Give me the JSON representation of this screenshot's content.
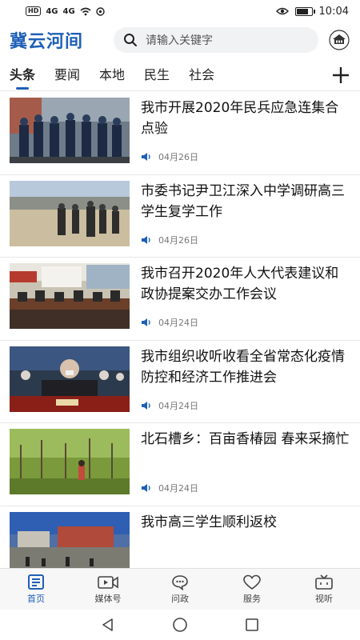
{
  "status_bar": {
    "network_badge": "HD",
    "signal1": "4G",
    "signal2": "4G",
    "time": "10:04",
    "battery_level": 0.85
  },
  "header": {
    "logo_text": "冀云河间",
    "search_placeholder": "请输入关键字"
  },
  "tabs": [
    {
      "label": "头条",
      "active": true
    },
    {
      "label": "要闻",
      "active": false
    },
    {
      "label": "本地",
      "active": false
    },
    {
      "label": "民生",
      "active": false
    },
    {
      "label": "社会",
      "active": false
    }
  ],
  "news": [
    {
      "title": "我市开展2020年民兵应急连集合点验",
      "date": "04月26日"
    },
    {
      "title": "市委书记尹卫江深入中学调研高三学生复学工作",
      "date": "04月26日"
    },
    {
      "title": "我市召开2020年人大代表建议和政协提案交办工作会议",
      "date": "04月24日"
    },
    {
      "title": "我市组织收听收看全省常态化疫情防控和经济工作推进会",
      "date": "04月24日"
    },
    {
      "title": "北石槽乡：百亩香椿园 春来采摘忙",
      "date": "04月24日"
    },
    {
      "title": "我市高三学生顺利返校",
      "date": ""
    }
  ],
  "bottom_nav": [
    {
      "label": "首页",
      "icon": "home-news-icon",
      "active": true
    },
    {
      "label": "媒体号",
      "icon": "video-icon",
      "active": false
    },
    {
      "label": "问政",
      "icon": "chat-bubble-icon",
      "active": false
    },
    {
      "label": "服务",
      "icon": "heart-icon",
      "active": false
    },
    {
      "label": "视听",
      "icon": "tv-icon",
      "active": false
    }
  ],
  "colors": {
    "brand": "#1f5fb7",
    "text": "#111111",
    "muted": "#777777"
  }
}
